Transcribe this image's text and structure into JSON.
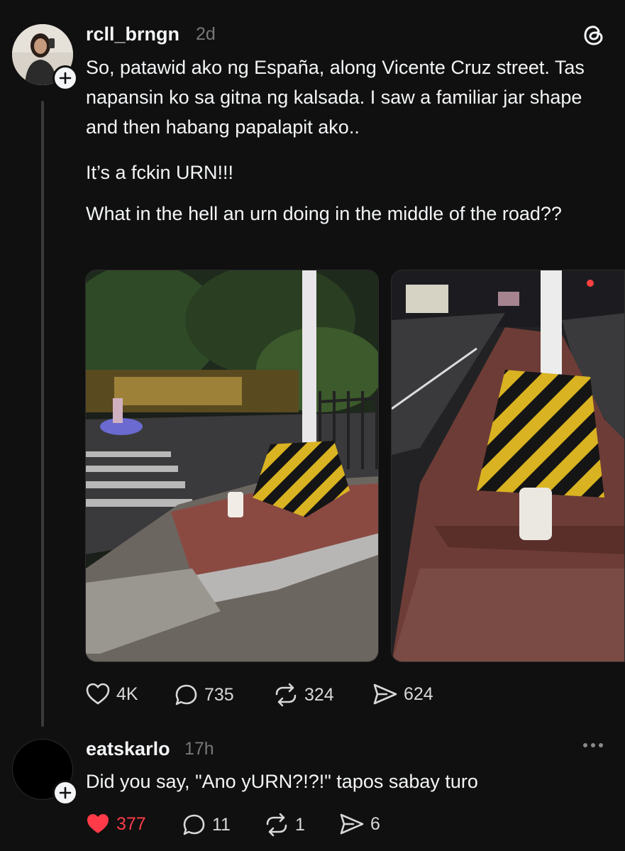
{
  "post": {
    "username": "rcll_brngn",
    "time": "2d",
    "paragraphs": [
      "So, patawid ako ng España, along Vicente Cruz street. Tas napansin ko sa gitna ng kalsada. I saw a familiar jar shape and then habang papalapit ako..",
      "It’s a fckin URN!!!",
      "What in the hell an urn doing in the middle of the road??"
    ],
    "actions": {
      "likes": "4K",
      "replies": "735",
      "reposts": "324",
      "shares": "624"
    }
  },
  "reply": {
    "username": "eatskarlo",
    "time": "17h",
    "text": "Did you say, \"Ano yURN?!?!\" tapos sabay turo",
    "actions": {
      "likes": "377",
      "replies": "11",
      "reposts": "1",
      "shares": "6"
    }
  },
  "colors": {
    "background": "#101010",
    "text": "#f3f5f7",
    "muted": "#777777",
    "like_active": "#ff3b4a"
  },
  "icons": [
    "threads-logo-icon",
    "plus-icon",
    "heart-icon",
    "comment-icon",
    "repost-icon",
    "share-icon",
    "more-icon"
  ]
}
